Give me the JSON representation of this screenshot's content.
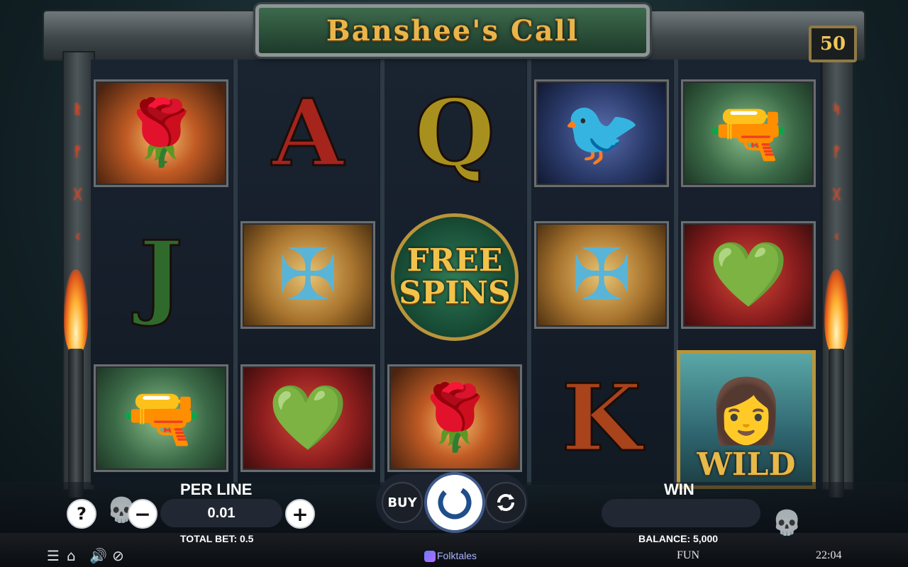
{
  "game": {
    "title": "Banshee's Call",
    "lines": "50"
  },
  "reels": {
    "symbols": [
      [
        "rose",
        "J",
        "pistol"
      ],
      [
        "A",
        "celtic-cross",
        "claddagh"
      ],
      [
        "Q",
        "free-spins",
        "rose"
      ],
      [
        "raven",
        "celtic-cross",
        "K"
      ],
      [
        "pistol",
        "claddagh",
        "wild"
      ]
    ],
    "free_spins_line1": "FREE",
    "free_spins_line2": "SPINS",
    "wild_label": "WILD",
    "letter_a": "A",
    "letter_q": "Q",
    "letter_j": "J",
    "letter_k": "K"
  },
  "controls": {
    "help_label": "?",
    "per_line_label": "PER LINE",
    "per_line_value": "0.01",
    "minus_label": "−",
    "plus_label": "+",
    "total_bet": "TOTAL BET: 0.5",
    "buy_label": "BUY",
    "win_label": "WIN",
    "win_value": "",
    "balance": "BALANCE: 5,000"
  },
  "footer": {
    "mode": "FUN",
    "time": "22:04",
    "provider": "Folktales"
  },
  "icons": {
    "menu": "menu-icon",
    "home": "home-icon",
    "sound": "speaker-icon",
    "turbo": "turbo-icon"
  }
}
